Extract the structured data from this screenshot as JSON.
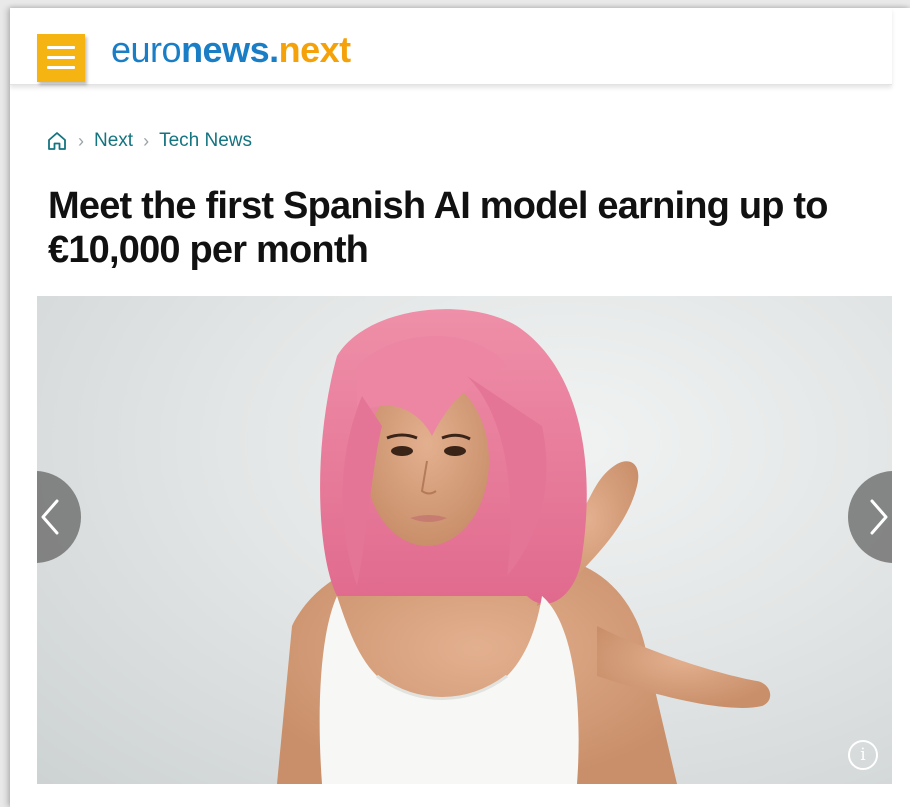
{
  "header": {
    "logo_part1": "euro",
    "logo_part2": "news.",
    "logo_part3": "next",
    "menu_icon": "hamburger-menu-icon",
    "brand_colors": {
      "menu": "#f5b412",
      "logo_blue": "#1a7ec7",
      "logo_orange": "#f5a20a"
    }
  },
  "breadcrumb": {
    "home_icon": "home-icon",
    "items": [
      {
        "label": "Next"
      },
      {
        "label": "Tech News"
      }
    ],
    "link_color": "#147480"
  },
  "article": {
    "title": "Meet the first Spanish AI model earning up to €10,000 per month"
  },
  "gallery": {
    "image_subject": "portrait-photo",
    "prev_icon": "chevron-left-icon",
    "next_icon": "chevron-right-icon",
    "info_icon": "info-icon",
    "info_glyph": "i"
  }
}
